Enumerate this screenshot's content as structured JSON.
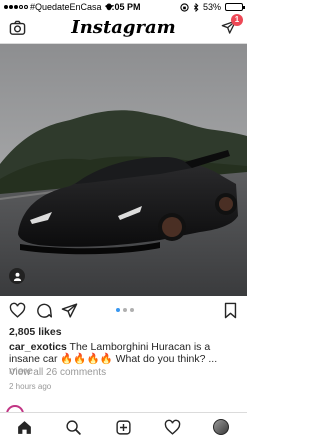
{
  "status_bar": {
    "carrier": "#QuedateEnCasa",
    "time": "3:05 PM",
    "battery": "53%",
    "battery_level": 0.53
  },
  "header": {
    "title": "Instagram",
    "dm_badge": "1"
  },
  "post": {
    "likes": "2,805 likes",
    "username": "car_exotics",
    "caption": "The Lamborghini Huracan is a insane car 🔥🔥🔥🔥 What do you think? ...",
    "more_label": "more",
    "view_comments": "View all 26 comments",
    "time_ago": "2 hours ago",
    "pager_count": 3,
    "pager_active": 1
  },
  "colors": {
    "accent": "#3897f0",
    "badge": "#ed4956",
    "text": "#262626",
    "muted": "#999999"
  },
  "icons": {
    "camera": "camera-icon",
    "direct": "direct-message-icon",
    "like": "heart-icon",
    "comment": "comment-icon",
    "share": "share-icon",
    "save": "bookmark-icon",
    "home": "home-icon",
    "search": "search-icon",
    "add": "add-post-icon",
    "activity": "heart-icon",
    "profile": "profile-avatar"
  }
}
